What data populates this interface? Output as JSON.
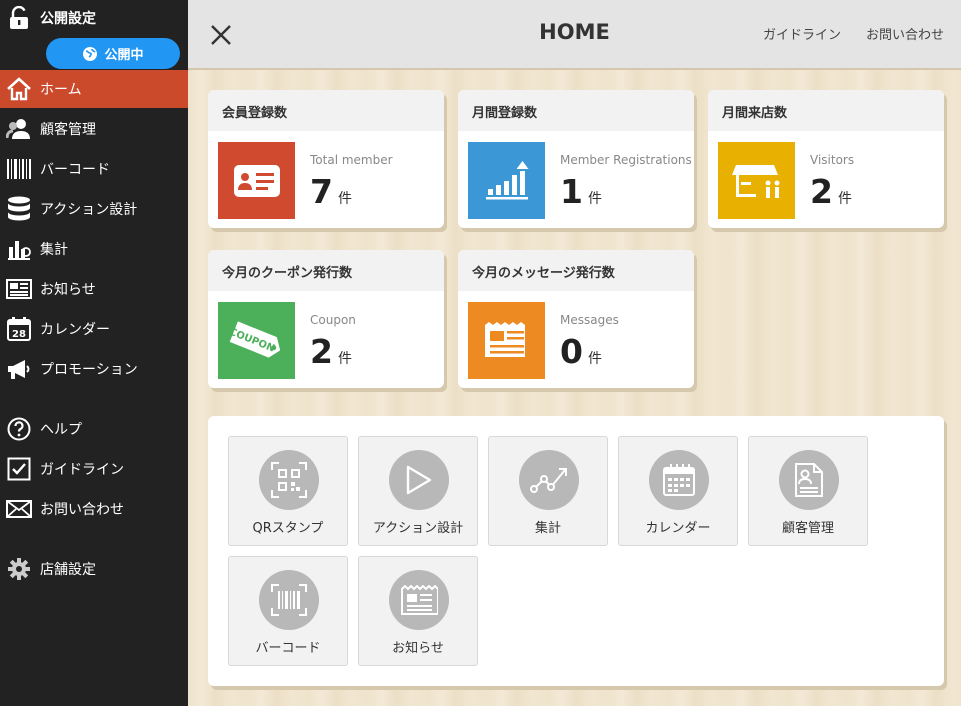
{
  "sidebar": {
    "publish_label": "公開設定",
    "publish_status": "公開中",
    "items": [
      {
        "label": "ホーム"
      },
      {
        "label": "顧客管理"
      },
      {
        "label": "バーコード"
      },
      {
        "label": "アクション設計"
      },
      {
        "label": "集計"
      },
      {
        "label": "お知らせ"
      },
      {
        "label": "カレンダー"
      },
      {
        "label": "プロモーション"
      },
      {
        "label": "ヘルプ"
      },
      {
        "label": "ガイドライン"
      },
      {
        "label": "お問い合わせ"
      },
      {
        "label": "店舗設定"
      }
    ]
  },
  "header": {
    "title": "HOME",
    "links": [
      "ガイドライン",
      "お問い合わせ"
    ]
  },
  "cards": [
    {
      "title": "会員登録数",
      "sub": "Total member",
      "value": "7",
      "unit": "件",
      "color": "#d04a30",
      "icon": "member-card-icon"
    },
    {
      "title": "月間登録数",
      "sub": "Member Registrations",
      "value": "1",
      "unit": "件",
      "color": "#3c97d6",
      "icon": "growth-chart-icon"
    },
    {
      "title": "月間来店数",
      "sub": "Visitors",
      "value": "2",
      "unit": "件",
      "color": "#e8b000",
      "icon": "store-icon"
    },
    {
      "title": "今月のクーポン発行数",
      "sub": "Coupon",
      "value": "2",
      "unit": "件",
      "color": "#4caf5a",
      "icon": "coupon-icon"
    },
    {
      "title": "今月のメッセージ発行数",
      "sub": "Messages",
      "value": "0",
      "unit": "件",
      "color": "#ee8a22",
      "icon": "newspaper-icon"
    }
  ],
  "coupon_icon_text": "COUPON",
  "calendar_icon_text": "28",
  "shortcuts": [
    {
      "label": "QRスタンプ",
      "icon": "qr-code-icon"
    },
    {
      "label": "アクション設計",
      "icon": "play-icon"
    },
    {
      "label": "集計",
      "icon": "line-chart-icon"
    },
    {
      "label": "カレンダー",
      "icon": "calendar-icon"
    },
    {
      "label": "顧客管理",
      "icon": "document-icon"
    },
    {
      "label": "バーコード",
      "icon": "barcode-icon"
    },
    {
      "label": "お知らせ",
      "icon": "newspaper-icon"
    }
  ]
}
